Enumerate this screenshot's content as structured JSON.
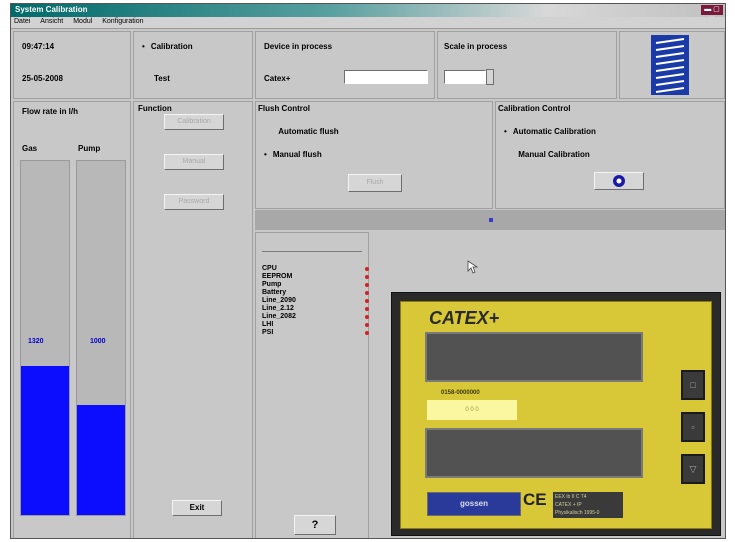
{
  "window": {
    "title": "System Calibration",
    "controls": "▬ ▢ ✕"
  },
  "menu": [
    "Datei",
    "Ansicht",
    "Modul",
    "Konfiguration"
  ],
  "info": {
    "time": "09:47:14",
    "date": "25-05-2008"
  },
  "mode": {
    "calibration": "Calibration",
    "test": "Test"
  },
  "device": {
    "label": "Device in process",
    "name": "Catex+",
    "value": "",
    "scale_label": "Scale in process",
    "scale_value": ""
  },
  "flow": {
    "title": "Flow rate in l/h",
    "gas_label": "Gas",
    "pump_label": "Pump",
    "gas_value": "1320",
    "pump_value": "1000",
    "gas_fraction": 0.42,
    "pump_fraction": 0.31
  },
  "function": {
    "title": "Function",
    "buttons": [
      "Calibration",
      "Manual",
      "Password"
    ],
    "exit": "Exit"
  },
  "flush": {
    "title": "Flush Control",
    "automatic": "Automatic flush",
    "manual": "Manual flush",
    "button": "Flush"
  },
  "calib": {
    "title": "Calibration Control",
    "automatic": "Automatic Calibration",
    "manual": "Manual Calibration"
  },
  "components": {
    "items": [
      "CPU",
      "EEPROM",
      "Pump",
      "Battery",
      "Line_2090",
      "Line_2.12",
      "Line_2082",
      "LHI",
      "PSI"
    ],
    "help": "?"
  },
  "device_image": {
    "brand": "CATEX+",
    "small_text": "0158-0000000",
    "label_text": "0 0 0",
    "maker": "gossen",
    "ce": "CE",
    "spec": "EEX ib II C T4\nCATEX + IP\nPhysikalisch 1995-0"
  }
}
